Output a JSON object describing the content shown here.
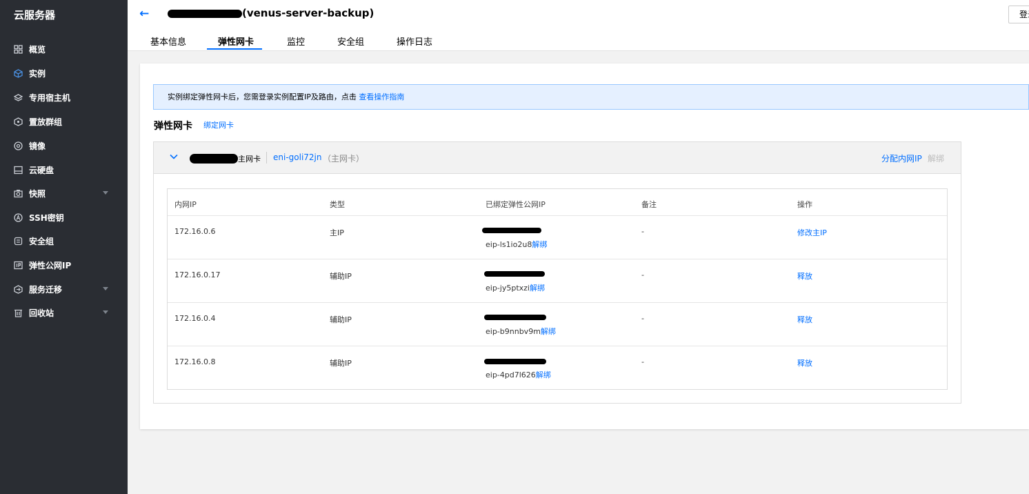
{
  "sidebar": {
    "title": "云服务器",
    "items": [
      {
        "label": "概览",
        "icon": "grid-icon",
        "caret": false,
        "active": false
      },
      {
        "label": "实例",
        "icon": "cube-icon",
        "caret": false,
        "active": true
      },
      {
        "label": "专用宿主机",
        "icon": "host-icon",
        "caret": false,
        "active": false
      },
      {
        "label": "置放群组",
        "icon": "group-icon",
        "caret": false,
        "active": false
      },
      {
        "label": "镜像",
        "icon": "disc-icon",
        "caret": false,
        "active": false
      },
      {
        "label": "云硬盘",
        "icon": "disk-icon",
        "caret": false,
        "active": false
      },
      {
        "label": "快照",
        "icon": "camera-icon",
        "caret": true,
        "active": false
      },
      {
        "label": "SSH密钥",
        "icon": "key-icon",
        "caret": false,
        "active": false
      },
      {
        "label": "安全组",
        "icon": "shield-icon",
        "caret": false,
        "active": false
      },
      {
        "label": "弹性公网IP",
        "icon": "ip-icon",
        "caret": false,
        "active": false
      },
      {
        "label": "服务迁移",
        "icon": "migrate-icon",
        "caret": true,
        "active": false
      },
      {
        "label": "回收站",
        "icon": "trash-icon",
        "caret": true,
        "active": false
      }
    ]
  },
  "header": {
    "title": "(venus-server-backup)",
    "login_button": "登录",
    "tabs": [
      {
        "label": "基本信息"
      },
      {
        "label": "弹性网卡"
      },
      {
        "label": "监控"
      },
      {
        "label": "安全组"
      },
      {
        "label": "操作日志"
      }
    ]
  },
  "notice": {
    "text": "实例绑定弹性网卡后，您需登录实例配置IP及路由，点击 ",
    "link": "查看操作指南"
  },
  "section": {
    "title": "弹性网卡",
    "bind_link": "绑定网卡"
  },
  "eni": {
    "tag": "主网卡",
    "id": "eni-goli72jn",
    "type": "（主网卡）",
    "allocate": "分配内网IP",
    "unbind": "解绑"
  },
  "table": {
    "headers": [
      "内网IP",
      "类型",
      "已绑定弹性公网IP",
      "备注",
      "操作"
    ],
    "rows": [
      {
        "ip": "172.16.0.6",
        "type": "主IP",
        "eip": "eip-ls1io2u8",
        "eip_action": "解绑",
        "note": "-",
        "action": "修改主IP"
      },
      {
        "ip": "172.16.0.17",
        "type": "辅助IP",
        "eip": "eip-jy5ptxzi",
        "eip_action": "解绑",
        "note": "-",
        "action": "释放"
      },
      {
        "ip": "172.16.0.4",
        "type": "辅助IP",
        "eip": "eip-b9nnbv9m",
        "eip_action": "解绑",
        "note": "-",
        "action": "释放"
      },
      {
        "ip": "172.16.0.8",
        "type": "辅助IP",
        "eip": "eip-4pd7l626",
        "eip_action": "解绑",
        "note": "-",
        "action": "释放"
      }
    ]
  },
  "colors": {
    "sidebar_bg": "#2a2d33",
    "accent": "#006eff",
    "notice_bg": "#e5f0ff"
  }
}
